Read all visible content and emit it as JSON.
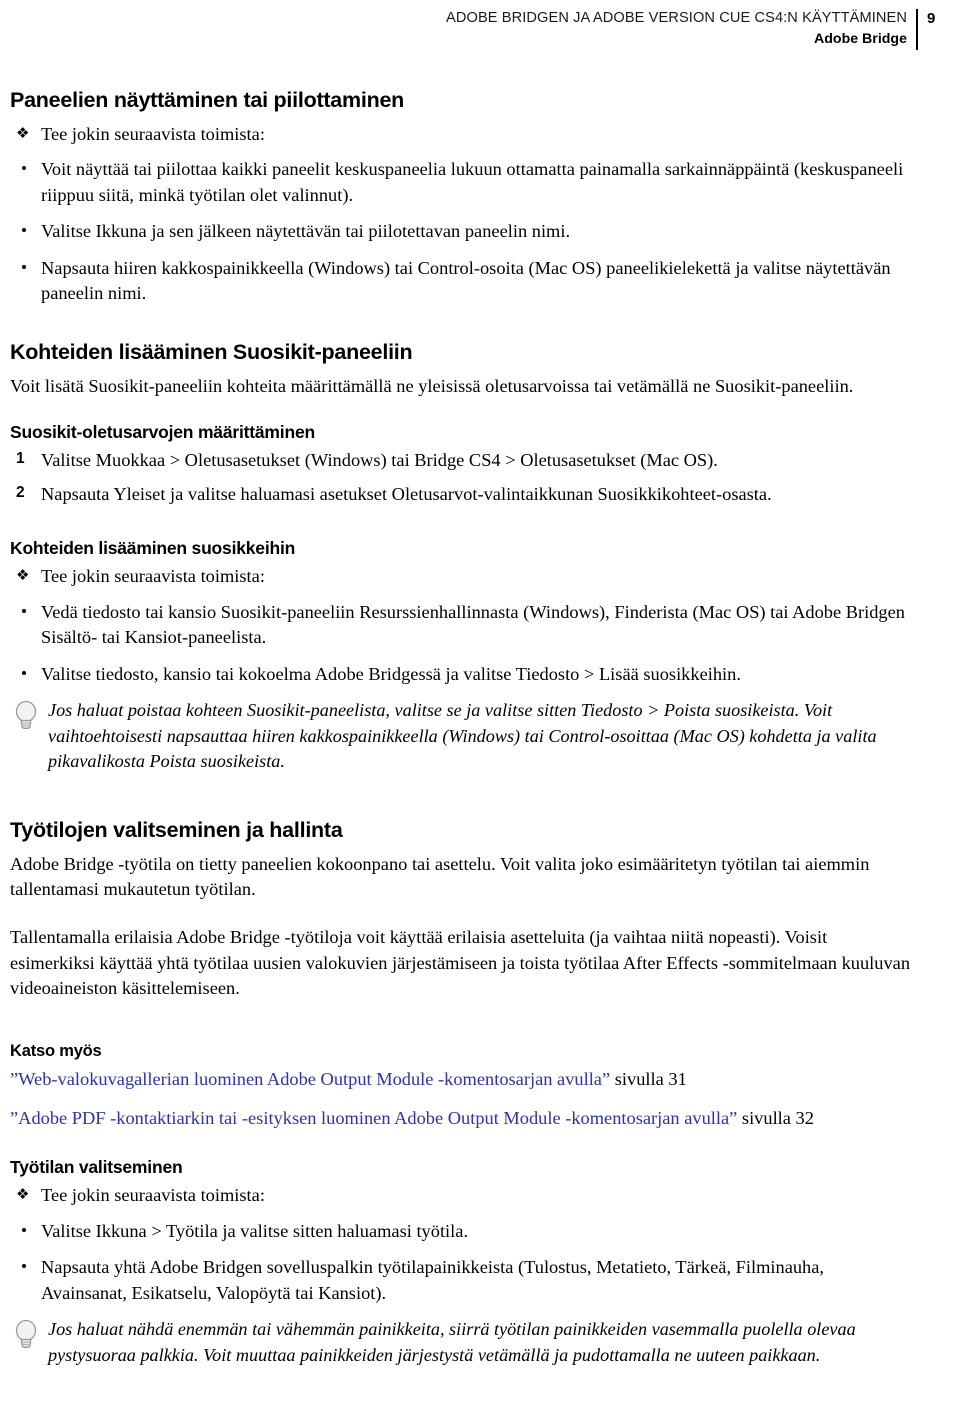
{
  "header": {
    "title": "ADOBE BRIDGEN JA ADOBE VERSION CUE CS4:N KÄYTTÄMINEN",
    "subtitle": "Adobe Bridge",
    "page_number": "9"
  },
  "colors": {
    "link": "#2b32b2",
    "text": "#000000",
    "bulb_outline": "#9a9a9a"
  },
  "sections": {
    "panels": {
      "heading": "Paneelien näyttäminen tai piilottaminen",
      "action_intro": "Tee jokin seuraavista toimista:",
      "bullets": [
        "Voit näyttää tai piilottaa kaikki paneelit keskuspaneelia lukuun ottamatta painamalla sarkainnäppäintä (keskuspaneeli riippuu siitä, minkä työtilan olet valinnut).",
        "Valitse Ikkuna ja sen jälkeen näytettävän tai piilotettavan paneelin nimi.",
        "Napsauta hiiren kakkospainikkeella (Windows) tai Control-osoita (Mac OS) paneelikielekettä ja valitse näytettävän paneelin nimi."
      ]
    },
    "favorites_panel": {
      "heading": "Kohteiden lisääminen Suosikit-paneeliin",
      "intro": "Voit lisätä Suosikit-paneeliin kohteita määrittämällä ne yleisissä oletusarvoissa tai vetämällä ne Suosikit-paneeliin."
    },
    "favorites_prefs": {
      "heading": "Suosikit-oletusarvojen määrittäminen",
      "steps": [
        {
          "num": "1",
          "text": "Valitse Muokkaa > Oletusasetukset (Windows) tai Bridge CS4 > Oletusasetukset (Mac OS)."
        },
        {
          "num": "2",
          "text": "Napsauta Yleiset ja valitse haluamasi asetukset Oletusarvot-valintaikkunan Suosikkikohteet-osasta."
        }
      ]
    },
    "add_favorites": {
      "heading": "Kohteiden lisääminen suosikkeihin",
      "action_intro": "Tee jokin seuraavista toimista:",
      "bullets": [
        "Vedä tiedosto tai kansio Suosikit-paneeliin Resurssienhallinnasta (Windows), Finderista (Mac OS) tai Adobe Bridgen Sisältö- tai Kansiot-paneelista.",
        "Valitse tiedosto, kansio tai kokoelma Adobe Bridgessä ja valitse Tiedosto > Lisää suosikkeihin."
      ],
      "tip": "Jos haluat poistaa kohteen Suosikit-paneelista, valitse se ja valitse sitten Tiedosto > Poista suosikeista.  Voit vaihtoehtoisesti napsauttaa hiiren kakkospainikkeella (Windows) tai Control-osoittaa (Mac OS) kohdetta ja valita pikavalikosta Poista suosikeista."
    },
    "workspaces": {
      "heading": "Työtilojen valitseminen ja hallinta",
      "paragraphs": [
        "Adobe Bridge -työtila on tietty paneelien kokoonpano tai asettelu.  Voit valita joko esimääritetyn työtilan tai aiemmin tallentamasi mukautetun työtilan.",
        "Tallentamalla erilaisia Adobe Bridge -työtiloja voit käyttää erilaisia asetteluita (ja vaihtaa niitä nopeasti).  Voisit esimerkiksi käyttää yhtä työtilaa uusien valokuvien järjestämiseen ja toista työtilaa After Effects -sommitelmaan kuuluvan videoaineiston käsittelemiseen."
      ]
    },
    "see_also": {
      "heading": "Katso myös",
      "links": [
        {
          "label": "”Web-valokuvagallerian luominen Adobe Output Module -komentosarjan avulla”",
          "after": " sivulla 31"
        },
        {
          "label": "”Adobe PDF -kontaktiarkin tai -esityksen luominen Adobe Output Module -komentosarjan avulla”",
          "after": " sivulla 32"
        }
      ]
    },
    "select_workspace": {
      "heading": "Työtilan valitseminen",
      "action_intro": "Tee jokin seuraavista toimista:",
      "bullets": [
        "Valitse Ikkuna > Työtila ja valitse sitten haluamasi työtila.",
        "Napsauta yhtä Adobe Bridgen sovelluspalkin työtilapainikkeista (Tulostus, Metatieto, Tärkeä, Filminauha, Avainsanat, Esikatselu, Valopöytä tai Kansiot)."
      ],
      "tip": "Jos haluat nähdä enemmän tai vähemmän painikkeita, siirrä työtilan painikkeiden vasemmalla puolella olevaa pystysuoraa palkkia. Voit muuttaa painikkeiden järjestystä vetämällä ja pudottamalla ne uuteen paikkaan."
    }
  }
}
